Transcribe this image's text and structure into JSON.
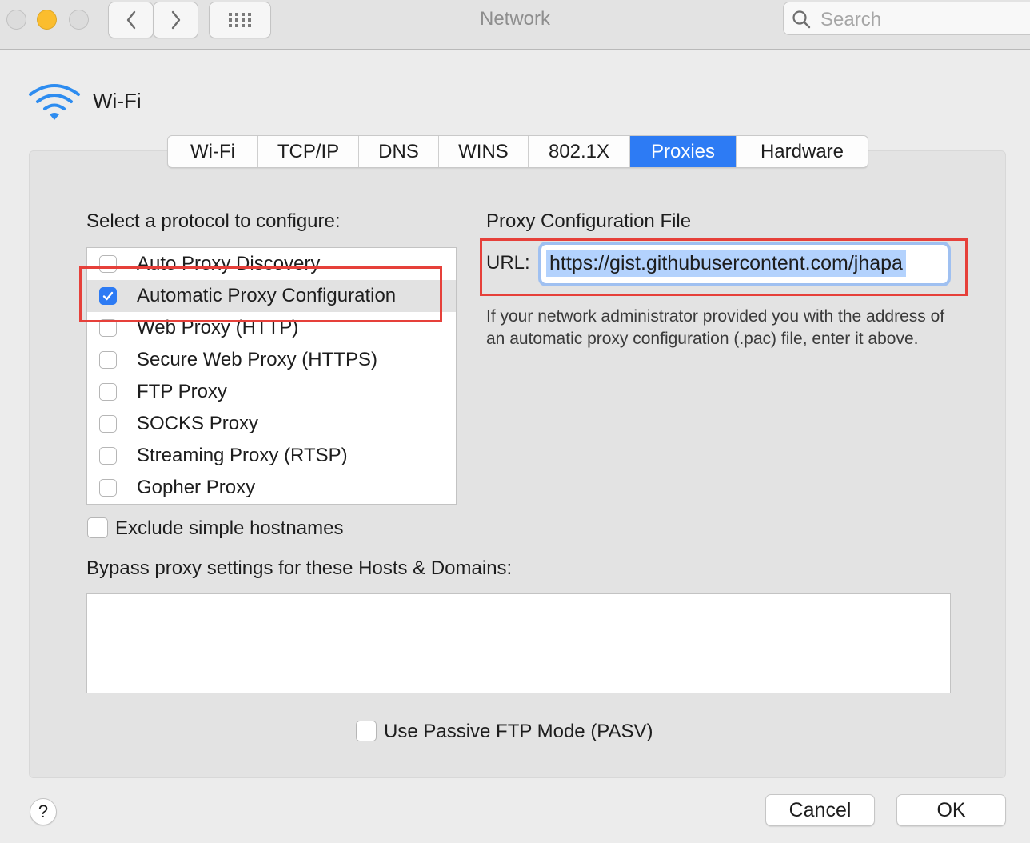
{
  "window": {
    "title": "Network",
    "search_placeholder": "Search"
  },
  "interface": {
    "name": "Wi-Fi",
    "icon": "wifi-icon"
  },
  "tabs": [
    {
      "label": "Wi-Fi",
      "active": false
    },
    {
      "label": "TCP/IP",
      "active": false
    },
    {
      "label": "DNS",
      "active": false
    },
    {
      "label": "WINS",
      "active": false
    },
    {
      "label": "802.1X",
      "active": false
    },
    {
      "label": "Proxies",
      "active": true
    },
    {
      "label": "Hardware",
      "active": false
    }
  ],
  "protocols": {
    "heading": "Select a protocol to configure:",
    "items": [
      {
        "label": "Auto Proxy Discovery",
        "checked": false,
        "selected": false
      },
      {
        "label": "Automatic Proxy Configuration",
        "checked": true,
        "selected": true
      },
      {
        "label": "Web Proxy (HTTP)",
        "checked": false,
        "selected": false
      },
      {
        "label": "Secure Web Proxy (HTTPS)",
        "checked": false,
        "selected": false
      },
      {
        "label": "FTP Proxy",
        "checked": false,
        "selected": false
      },
      {
        "label": "SOCKS Proxy",
        "checked": false,
        "selected": false
      },
      {
        "label": "Streaming Proxy (RTSP)",
        "checked": false,
        "selected": false
      },
      {
        "label": "Gopher Proxy",
        "checked": false,
        "selected": false
      }
    ]
  },
  "config": {
    "heading": "Proxy Configuration File",
    "url_label": "URL:",
    "url_value": "https://gist.githubusercontent.com/jhapa",
    "help_text": "If your network administrator provided you with the address of an automatic proxy configuration (.pac) file, enter it above."
  },
  "exclude_simple_hostnames": {
    "label": "Exclude simple hostnames",
    "checked": false
  },
  "bypass": {
    "label": "Bypass proxy settings for these Hosts & Domains:",
    "value": ""
  },
  "passive_ftp": {
    "label": "Use Passive FTP Mode (PASV)",
    "checked": false
  },
  "buttons": {
    "help": "?",
    "cancel": "Cancel",
    "ok": "OK"
  },
  "colors": {
    "accent": "#2d7bf4",
    "annotation": "#e6403a"
  }
}
